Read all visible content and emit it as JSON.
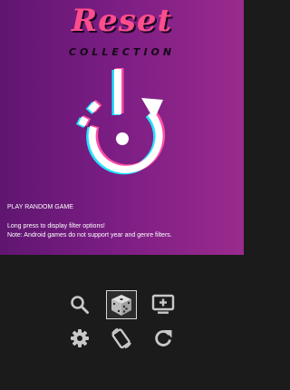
{
  "header": {
    "title": "Reset",
    "subtitle": "COLLECTION"
  },
  "section": {
    "title": "PLAY RANDOM GAME",
    "hint_line1": "Long press to display filter options!",
    "hint_line2": "Note: Android games do not support year and genre filters."
  },
  "toolbar": {
    "items": [
      {
        "icon": "search-icon",
        "selected": false
      },
      {
        "icon": "dice-icon",
        "selected": true
      },
      {
        "icon": "tv-add-icon",
        "selected": false
      },
      {
        "icon": "gear-icon",
        "selected": false
      },
      {
        "icon": "rotate-screen-icon",
        "selected": false
      },
      {
        "icon": "refresh-icon",
        "selected": false
      }
    ]
  },
  "colors": {
    "hero_gradient_start": "#5f1670",
    "hero_gradient_end": "#9b2a8d",
    "logo_pink": "#ff4d8d",
    "toolbar_bg": "#1b1b1b",
    "icon_gray": "#c8c8c8"
  }
}
